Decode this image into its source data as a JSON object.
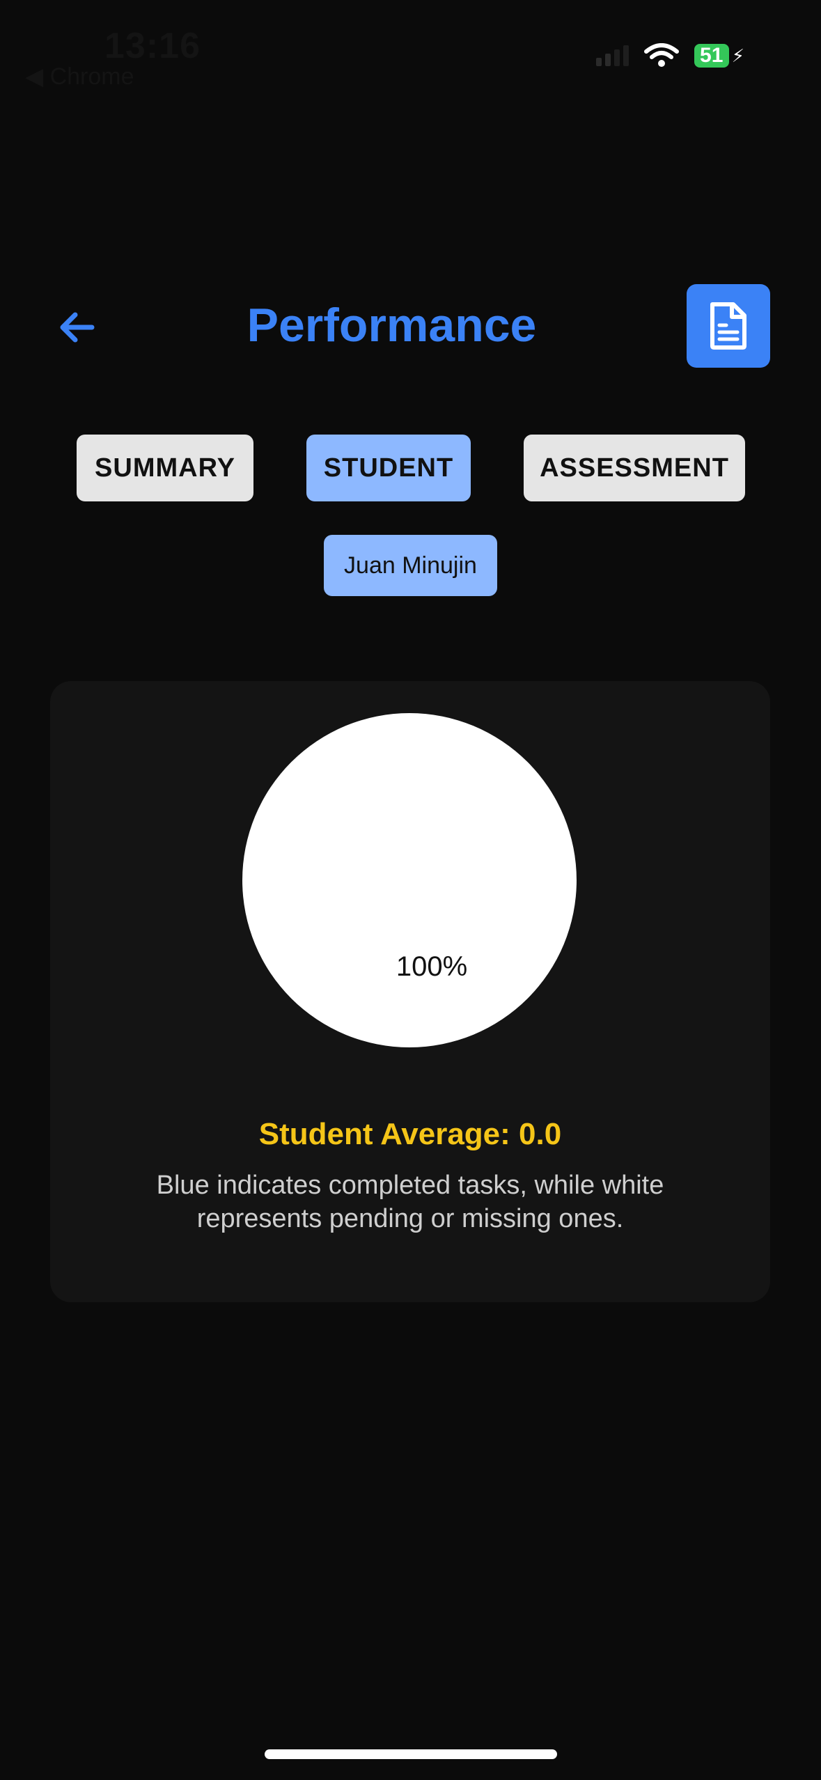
{
  "status_bar": {
    "time": "13:16",
    "back_app": "◀ Chrome",
    "battery": "51"
  },
  "header": {
    "title": "Performance",
    "back_icon": "arrow-left-icon",
    "report_icon": "document-icon"
  },
  "tabs": [
    {
      "label": "SUMMARY",
      "active": false
    },
    {
      "label": "STUDENT",
      "active": true
    },
    {
      "label": "ASSESSMENT",
      "active": false
    }
  ],
  "selected_student": "Juan Minujin",
  "card": {
    "pie_label": "100%",
    "average_text": "Student Average: 0.0",
    "note": "Blue indicates completed tasks, while white represents pending or missing ones."
  },
  "chart_data": {
    "type": "pie",
    "categories": [
      "Pending / Missing"
    ],
    "values": [
      100
    ],
    "labels": [
      "100%"
    ]
  },
  "colors": {
    "accent": "#3b82f6",
    "tab_active": "#8db8ff",
    "tab_inactive": "#e5e5e5",
    "average": "#f5c518",
    "pie_pending": "#ffffff"
  }
}
